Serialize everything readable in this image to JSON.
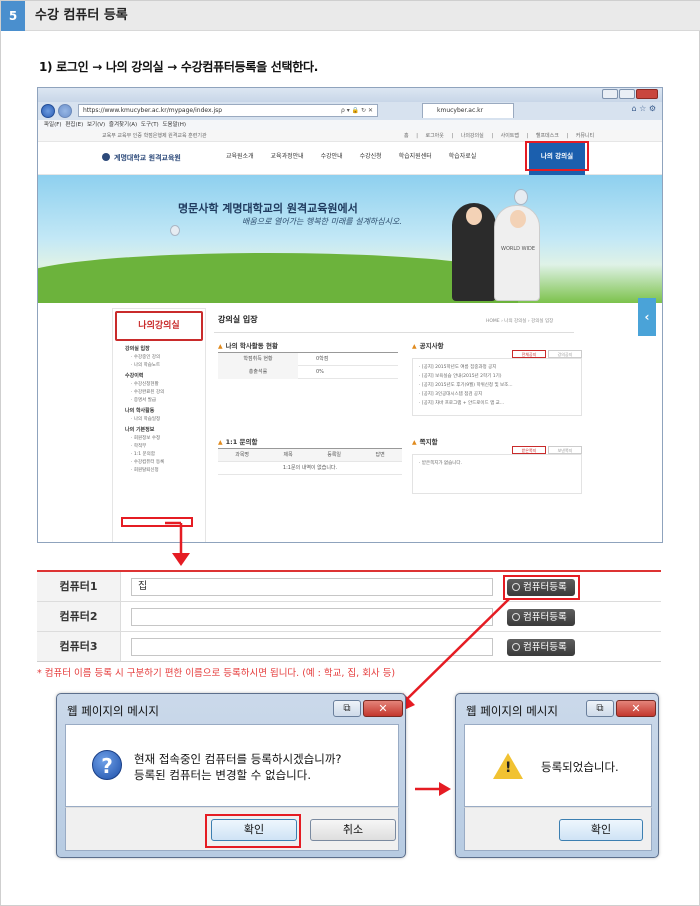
{
  "header": {
    "step_number": "5",
    "title": "수강 컴퓨터 등록"
  },
  "instruction": "1) 로그인 → 나의 강의실 → 수강컴퓨터등록을 선택한다.",
  "browser": {
    "url": "https://www.kmucyber.ac.kr/mypage/index.jsp",
    "url_controls": "ρ ▾ 🔒 ↻ ✕",
    "tab": "kmucyber.ac.kr",
    "menu": "파일(F) 편집(E) 보기(V) 즐겨찾기(A) 도구(T) 도움말(H)",
    "site": {
      "topbar_left": "교육부 교육부 인증 학점은행제 원격교육 훈련기관",
      "topbar_right": "홈 | 로그아웃 | 나의강의실 | 사이트맵 | 헬프데스크 | 커뮤니티",
      "logo": "계명대학교 원격교육원",
      "nav": [
        "교육원소개",
        "교육과정안내",
        "수강안내",
        "수강신청",
        "학습지원센터",
        "학습자료실"
      ],
      "nav_active": "나의 강의실",
      "subnav": "· 강의실 입장 · 수강이력 · 나의 학사활동",
      "banner_title": "명문사학 계명대학교의 원격교육원에서",
      "banner_sub": "배움으로 열어가는 행복한 미래를 설계하십시오.",
      "shirt_text": "WORLD WIDE",
      "lnb_title": "나의강의실",
      "lnb_groups": [
        {
          "title": "강의실 입장",
          "items": [
            "· 수강중인 강의",
            "· 나의 학습노트"
          ]
        },
        {
          "title": "수강이력",
          "items": [
            "· 수강신청현황",
            "· 수강완료된 강의",
            "· 증명서 발급"
          ]
        },
        {
          "title": "나의 학사활동",
          "items": [
            "· 나의 학습일정"
          ]
        },
        {
          "title": "나의 기본정보",
          "items": [
            "· 회원정보 수정",
            "· 학적부",
            "· 1:1 문의함",
            "· 수강컴퓨터 등록",
            "· 회원탈퇴신청"
          ]
        }
      ],
      "content_title": "강의실 입장",
      "breadcrumb": "HOME › 나의 강의실 › 강의실 입장",
      "activity_title": "나의 학사활동 현황",
      "activity_rows": [
        {
          "label": "학점취득 현황",
          "value": "0학점"
        },
        {
          "label": "총출석률",
          "value": "0%"
        }
      ],
      "notice_title": "공지사항",
      "notice_tabs": [
        "전체공지",
        "강의공지"
      ],
      "notices": [
        "· [공지] 2015학년도 여름 집중과정 공지",
        "· [공지] 보육실습 안내(2015년 2학기 1기)",
        "· [공지] 2015년도 후기(9월) 학위신청 및 보조...",
        "· [공지] 3인공대시스템 점검 공지",
        "· [공지] 차바 프로그램 + 안드로이드 앱 교..."
      ],
      "qna_title": "1:1 문의함",
      "qna_headers": [
        "과목명",
        "제목",
        "등록일",
        "답변"
      ],
      "qna_empty": "1:1문의 내역이 없습니다.",
      "memo_title": "쪽지함",
      "memo_tabs": [
        "받은쪽지",
        "보낸쪽지"
      ],
      "memo_empty": "· 받은쪽지가 없습니다."
    }
  },
  "form": {
    "rows": [
      {
        "label": "컴퓨터1",
        "value": "집",
        "button": "컴퓨터등록"
      },
      {
        "label": "컴퓨터2",
        "value": "",
        "button": "컴퓨터등록"
      },
      {
        "label": "컴퓨터3",
        "value": "",
        "button": "컴퓨터등록"
      }
    ],
    "note": "* 컴퓨터 이름 등록 시 구분하기 편한 이름으로 등록하시면 됩니다. (예 : 학교, 집, 회사 등)"
  },
  "dialog_confirm": {
    "title": "웹 페이지의 메시지",
    "icon": "question-icon",
    "icon_glyph": "?",
    "message_line1": "현재 접속중인 컴퓨터를 등록하시겠습니까?",
    "message_line2": "등록된 컴퓨터는 변경할 수 없습니다.",
    "ok": "확인",
    "cancel": "취소",
    "restore_glyph": "⧉",
    "close_glyph": "✕"
  },
  "dialog_done": {
    "title": "웹 페이지의 메시지",
    "icon": "warning-icon",
    "icon_glyph": "!",
    "message": "등록되었습니다.",
    "ok": "확인",
    "restore_glyph": "⧉",
    "close_glyph": "✕"
  },
  "colors": {
    "accent_red": "#e51c23",
    "step_blue": "#4a8fce",
    "nav_blue": "#1b5fae"
  }
}
